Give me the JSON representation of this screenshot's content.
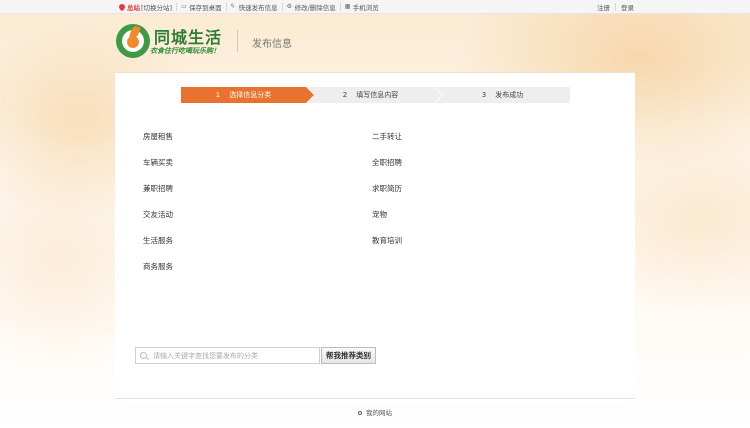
{
  "topbar": {
    "site_label": "总站",
    "switch_label": "[切换分站]",
    "links": [
      {
        "icon": "monitor-icon",
        "label": "保存到桌面"
      },
      {
        "icon": "lightning-icon",
        "label": "快速发布信息"
      },
      {
        "icon": "gear-icon",
        "label": "修改/删除信息"
      },
      {
        "icon": "qrcode-icon",
        "label": "手机浏览"
      }
    ],
    "register_label": "注册",
    "login_label": "登录"
  },
  "header": {
    "logo_title": "同城生活",
    "logo_slogan": "衣食住行吃喝玩乐购！",
    "page_heading": "发布信息"
  },
  "steps": [
    {
      "num": "1",
      "label": "选择信息分类",
      "state": "active"
    },
    {
      "num": "2",
      "label": "填写信息内容",
      "state": "inactive"
    },
    {
      "num": "3",
      "label": "发布成功",
      "state": "inactive"
    }
  ],
  "categories": {
    "left": [
      "房屋租售",
      "车辆买卖",
      "兼职招聘",
      "交友活动",
      "生活服务",
      "商务服务"
    ],
    "right": [
      "二手转让",
      "全职招聘",
      "求职简历",
      "宠物",
      "教育培训"
    ]
  },
  "search": {
    "placeholder": "请输入关键字查找您要发布的分类",
    "button_label": "帮我推荐类别"
  },
  "footer": {
    "label": "我的网站"
  },
  "colors": {
    "accent": "#e8722e",
    "logo_green": "#3f9a45",
    "site_red": "#e4393c"
  }
}
